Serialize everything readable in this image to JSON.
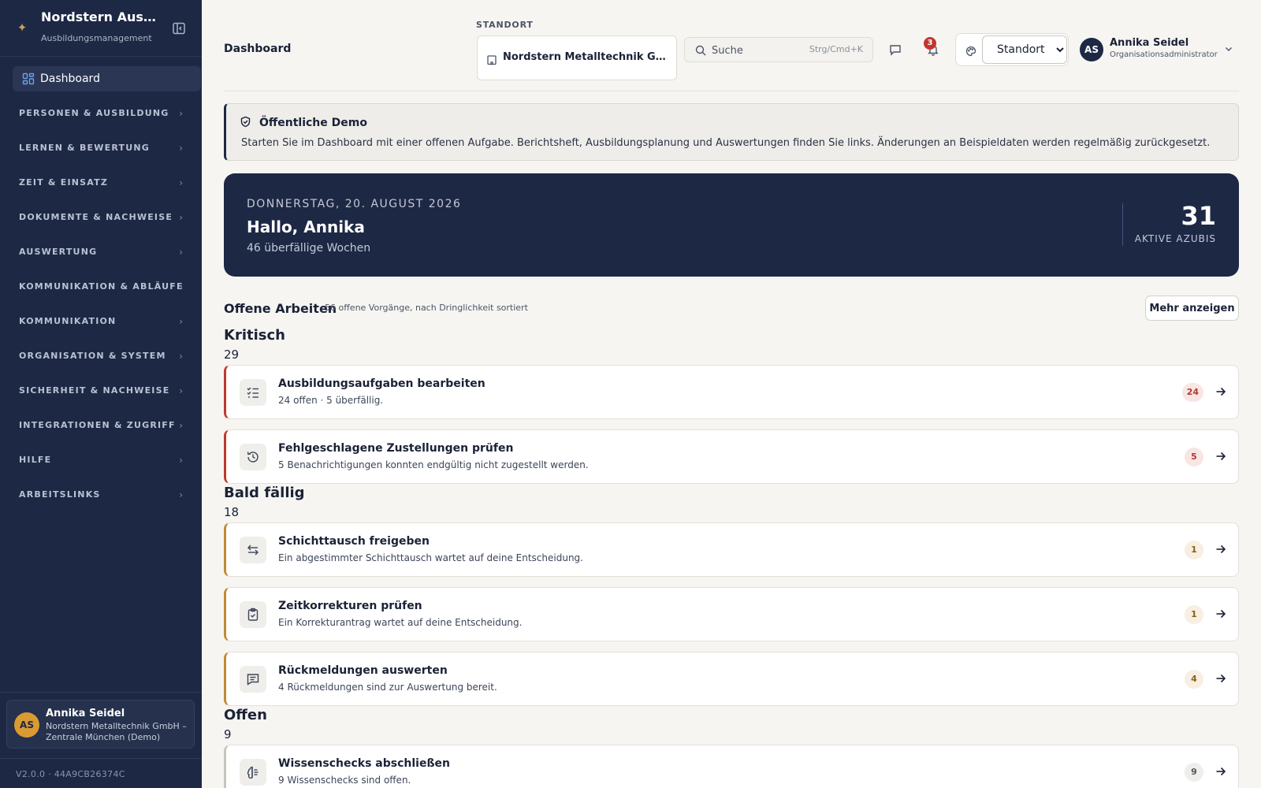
{
  "sidebar": {
    "brand_title": "Nordstern Ausbil...",
    "brand_subtitle": "Ausbildungsmanagement",
    "active_item": "Dashboard",
    "groups": [
      "PERSONEN & AUSBILDUNG",
      "LERNEN & BEWERTUNG",
      "ZEIT & EINSATZ",
      "DOKUMENTE & NACHWEISE",
      "AUSWERTUNG",
      "KOMMUNIKATION & ABLÄUFE",
      "KOMMUNIKATION",
      "ORGANISATION & SYSTEM",
      "SICHERHEIT & NACHWEISE",
      "INTEGRATIONEN & ZUGRIFF",
      "HILFE",
      "ARBEITSLINKS"
    ],
    "user": {
      "initials": "AS",
      "name": "Annika Seidel",
      "org": "Nordstern Metalltechnik GmbH – Zentrale München (Demo)"
    },
    "version": "V2.0.0 · 44A9CB26374C"
  },
  "header": {
    "title": "Dashboard",
    "standort_caption": "STANDORT",
    "standort_value": "Nordstern Metalltechnik GmbH – Zentrale München",
    "search_placeholder": "Suche",
    "search_shortcut": "Strg/Cmd+K",
    "notification_count": "3",
    "theme_select": "Standort",
    "user": {
      "initials": "AS",
      "name": "Annika Seidel",
      "role": "Organisationsadministrator"
    }
  },
  "demo_banner": {
    "title": "Öffentliche Demo",
    "text": "Starten Sie im Dashboard mit einer offenen Aufgabe. Berichtsheft, Ausbildungsplanung und Auswertungen finden Sie links. Änderungen an Beispieldaten werden regelmäßig zurückgesetzt."
  },
  "hero": {
    "date": "DONNERSTAG, 20. AUGUST 2026",
    "greeting": "Hallo, Annika",
    "subtitle": "46 überfällige Wochen",
    "stat_value": "31",
    "stat_label": "AKTIVE AZUBIS"
  },
  "open_work": {
    "title": "Offene Arbeiten",
    "subtitle": "56 offene Vorgänge, nach Dringlichkeit sortiert",
    "more_button": "Mehr anzeigen",
    "groups": [
      {
        "title": "Kritisch",
        "count": "29",
        "tasks": [
          {
            "title": "Ausbildungsaufgaben bearbeiten",
            "desc": "24 offen · 5 überfällig.",
            "count": "24",
            "icon": "checklist-icon"
          },
          {
            "title": "Fehlgeschlagene Zustellungen prüfen",
            "desc": "5 Benachrichtigungen konnten endgültig nicht zugestellt werden.",
            "count": "5",
            "icon": "clock-history-icon"
          }
        ]
      },
      {
        "title": "Bald fällig",
        "count": "18",
        "tasks": [
          {
            "title": "Schichttausch freigeben",
            "desc": "Ein abgestimmter Schichttausch wartet auf deine Entscheidung.",
            "count": "1",
            "icon": "swap-icon"
          },
          {
            "title": "Zeitkorrekturen prüfen",
            "desc": "Ein Korrekturantrag wartet auf deine Entscheidung.",
            "count": "1",
            "icon": "clipboard-check-icon"
          },
          {
            "title": "Rückmeldungen auswerten",
            "desc": "4 Rückmeldungen sind zur Auswertung bereit.",
            "count": "4",
            "icon": "message-icon"
          }
        ]
      },
      {
        "title": "Offen",
        "count": "9",
        "tasks": [
          {
            "title": "Wissenschecks abschließen",
            "desc": "9 Wissenschecks sind offen.",
            "count": "9",
            "icon": "brain-icon"
          }
        ]
      }
    ]
  }
}
